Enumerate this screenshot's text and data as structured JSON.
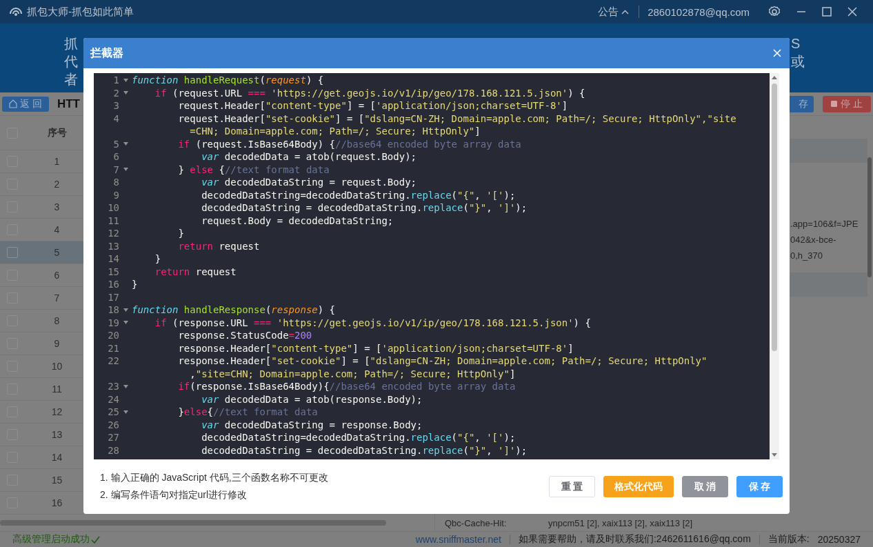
{
  "titlebar": {
    "app_title": "抓包大师-抓包如此简单",
    "notice": "公告",
    "account": "2860102878@qq.com"
  },
  "banner": {
    "rows": [
      {
        "left": "抓",
        "right": "S"
      },
      {
        "left": "代",
        "right": "或"
      },
      {
        "left": "者"
      }
    ]
  },
  "toolbar": {
    "back": "返 回",
    "title": "HTT",
    "save": "存",
    "stop": "停 止"
  },
  "table": {
    "header_checked": false,
    "columns": [
      "序号"
    ],
    "rows": [
      {
        "number": "1",
        "checked": false,
        "selected": false
      },
      {
        "number": "2",
        "checked": false,
        "selected": false
      },
      {
        "number": "3",
        "checked": false,
        "selected": false
      },
      {
        "number": "4",
        "checked": false,
        "selected": false
      },
      {
        "number": "5",
        "checked": false,
        "selected": true
      },
      {
        "number": "6",
        "checked": false,
        "selected": false
      },
      {
        "number": "7",
        "checked": false,
        "selected": false
      },
      {
        "number": "8",
        "checked": false,
        "selected": false
      },
      {
        "number": "9",
        "checked": false,
        "selected": false
      },
      {
        "number": "10",
        "checked": false,
        "selected": false
      },
      {
        "number": "11",
        "checked": false,
        "selected": false
      },
      {
        "number": "12",
        "checked": false,
        "selected": false
      },
      {
        "number": "13",
        "checked": false,
        "selected": false
      },
      {
        "number": "14",
        "checked": false,
        "selected": false
      },
      {
        "number": "15",
        "checked": false,
        "selected": false
      },
      {
        "number": "16",
        "checked": false,
        "selected": false
      }
    ]
  },
  "detail": {
    "lines": [
      ".app=106&f=JPE",
      "042&x-bce-",
      "0,h_370"
    ],
    "header_name": "Qbc-Cache-Hit:",
    "header_value": "ynpcm51 [2], xaix113 [2], xaix113 [2]"
  },
  "dialog": {
    "title": "拦截器",
    "code": [
      {
        "number": "1",
        "fold": true,
        "tokens": [
          {
            "kind": "decl",
            "text": "function"
          },
          {
            "kind": "name",
            "text": " handleRequest"
          },
          {
            "kind": "plain",
            "text": "("
          },
          {
            "kind": "param",
            "text": "request"
          },
          {
            "kind": "plain",
            "text": ") {"
          }
        ]
      },
      {
        "number": "2",
        "fold": true,
        "tokens": [
          {
            "kind": "keyword",
            "text": "    if"
          },
          {
            "kind": "plain",
            "text": " (request.URL "
          },
          {
            "kind": "keyword",
            "text": "==="
          },
          {
            "kind": "string",
            "text": " 'https://get.geojs.io/v1/ip/geo/178.168.121.5.json'"
          },
          {
            "kind": "plain",
            "text": ") {"
          }
        ]
      },
      {
        "number": "3",
        "fold": false,
        "tokens": [
          {
            "kind": "plain",
            "text": "        request.Header["
          },
          {
            "kind": "string",
            "text": "\"content-type\""
          },
          {
            "kind": "plain",
            "text": "] = ["
          },
          {
            "kind": "string",
            "text": "'application/json;charset=UTF-8'"
          },
          {
            "kind": "plain",
            "text": "]"
          }
        ]
      },
      {
        "number": "4",
        "fold": false,
        "tokens": [
          {
            "kind": "plain",
            "text": "        request.Header["
          },
          {
            "kind": "string",
            "text": "\"set-cookie\""
          },
          {
            "kind": "plain",
            "text": "] = ["
          },
          {
            "kind": "string",
            "text": "\"dslang=CN-ZH; Domain=apple.com; Path=/; Secure; HttpOnly\","
          },
          {
            "kind": "string",
            "text": "\"site"
          }
        ]
      },
      {
        "fold": false,
        "tokens": [
          {
            "kind": "string",
            "text": "          =CHN; Domain=apple.com; Path=/; Secure; HttpOnly\""
          },
          {
            "kind": "plain",
            "text": "]"
          }
        ]
      },
      {
        "number": "5",
        "fold": true,
        "tokens": [
          {
            "kind": "keyword",
            "text": "        if"
          },
          {
            "kind": "plain",
            "text": " (request.IsBase64Body) {"
          },
          {
            "kind": "comment",
            "text": "//base64 encoded byte array data"
          }
        ]
      },
      {
        "number": "6",
        "fold": false,
        "tokens": [
          {
            "kind": "decl",
            "text": "            var"
          },
          {
            "kind": "plain",
            "text": " decodedData = atob(request.Body);"
          }
        ]
      },
      {
        "number": "7",
        "fold": true,
        "tokens": [
          {
            "kind": "plain",
            "text": "        } "
          },
          {
            "kind": "keyword",
            "text": "else"
          },
          {
            "kind": "plain",
            "text": " {"
          },
          {
            "kind": "comment",
            "text": "//text format data"
          }
        ]
      },
      {
        "number": "8",
        "fold": false,
        "tokens": [
          {
            "kind": "decl",
            "text": "            var"
          },
          {
            "kind": "plain",
            "text": " decodedDataString = request.Body;"
          }
        ]
      },
      {
        "number": "9",
        "fold": false,
        "tokens": [
          {
            "kind": "plain",
            "text": "            decodedDataString=decodedDataString."
          },
          {
            "kind": "method",
            "text": "replace"
          },
          {
            "kind": "plain",
            "text": "("
          },
          {
            "kind": "string",
            "text": "\"{\""
          },
          {
            "kind": "plain",
            "text": ", "
          },
          {
            "kind": "string",
            "text": "'['"
          },
          {
            "kind": "plain",
            "text": ");"
          }
        ]
      },
      {
        "number": "10",
        "fold": false,
        "tokens": [
          {
            "kind": "plain",
            "text": "            decodedDataString = decodedDataString."
          },
          {
            "kind": "method",
            "text": "replace"
          },
          {
            "kind": "plain",
            "text": "("
          },
          {
            "kind": "string",
            "text": "\"}\""
          },
          {
            "kind": "plain",
            "text": ", "
          },
          {
            "kind": "string",
            "text": "']'"
          },
          {
            "kind": "plain",
            "text": ");"
          }
        ]
      },
      {
        "number": "11",
        "fold": false,
        "tokens": [
          {
            "kind": "plain",
            "text": "            request.Body = decodedDataString;"
          }
        ]
      },
      {
        "number": "12",
        "fold": false,
        "tokens": [
          {
            "kind": "plain",
            "text": "        }"
          }
        ]
      },
      {
        "number": "13",
        "fold": false,
        "tokens": [
          {
            "kind": "keyword",
            "text": "        return"
          },
          {
            "kind": "plain",
            "text": " request"
          }
        ]
      },
      {
        "number": "14",
        "fold": false,
        "tokens": [
          {
            "kind": "plain",
            "text": "    }"
          }
        ]
      },
      {
        "number": "15",
        "fold": false,
        "tokens": [
          {
            "kind": "keyword",
            "text": "    return"
          },
          {
            "kind": "plain",
            "text": " request"
          }
        ]
      },
      {
        "number": "16",
        "fold": false,
        "tokens": [
          {
            "kind": "plain",
            "text": "}"
          }
        ]
      },
      {
        "number": "17",
        "fold": false
      },
      {
        "number": "18",
        "fold": true,
        "tokens": [
          {
            "kind": "decl",
            "text": "function"
          },
          {
            "kind": "name",
            "text": " handleResponse"
          },
          {
            "kind": "plain",
            "text": "("
          },
          {
            "kind": "param",
            "text": "response"
          },
          {
            "kind": "plain",
            "text": ") {"
          }
        ]
      },
      {
        "number": "19",
        "fold": true,
        "tokens": [
          {
            "kind": "keyword",
            "text": "    if"
          },
          {
            "kind": "plain",
            "text": " (response.URL "
          },
          {
            "kind": "keyword",
            "text": "==="
          },
          {
            "kind": "string",
            "text": " 'https://get.geojs.io/v1/ip/geo/178.168.121.5.json'"
          },
          {
            "kind": "plain",
            "text": ") {"
          }
        ]
      },
      {
        "number": "20",
        "fold": false,
        "tokens": [
          {
            "kind": "plain",
            "text": "        response.StatusCode"
          },
          {
            "kind": "keyword",
            "text": "="
          },
          {
            "kind": "number",
            "text": "200"
          }
        ]
      },
      {
        "number": "21",
        "fold": false,
        "tokens": [
          {
            "kind": "plain",
            "text": "        response.Header["
          },
          {
            "kind": "string",
            "text": "\"content-type\""
          },
          {
            "kind": "plain",
            "text": "] = ["
          },
          {
            "kind": "string",
            "text": "'application/json;charset=UTF-8'"
          },
          {
            "kind": "plain",
            "text": "]"
          }
        ]
      },
      {
        "number": "22",
        "fold": false,
        "tokens": [
          {
            "kind": "plain",
            "text": "        response.Header["
          },
          {
            "kind": "string",
            "text": "\"set-cookie\""
          },
          {
            "kind": "plain",
            "text": "] = ["
          },
          {
            "kind": "string",
            "text": "\"dslang=CN-ZH; Domain=apple.com; Path=/; Secure; HttpOnly\""
          }
        ]
      },
      {
        "fold": false,
        "tokens": [
          {
            "kind": "plain",
            "text": "          ,"
          },
          {
            "kind": "string",
            "text": "\"site=CHN; Domain=apple.com; Path=/; Secure; HttpOnly\""
          },
          {
            "kind": "plain",
            "text": "]"
          }
        ]
      },
      {
        "number": "23",
        "fold": true,
        "tokens": [
          {
            "kind": "keyword",
            "text": "        if"
          },
          {
            "kind": "plain",
            "text": "(response.IsBase64Body){"
          },
          {
            "kind": "comment",
            "text": "//base64 encoded byte array data"
          }
        ]
      },
      {
        "number": "24",
        "fold": false,
        "tokens": [
          {
            "kind": "decl",
            "text": "            var"
          },
          {
            "kind": "plain",
            "text": " decodedData = atob(response.Body);"
          }
        ]
      },
      {
        "number": "25",
        "fold": true,
        "tokens": [
          {
            "kind": "plain",
            "text": "        }"
          },
          {
            "kind": "keyword",
            "text": "else"
          },
          {
            "kind": "plain",
            "text": "{"
          },
          {
            "kind": "comment",
            "text": "//text format data"
          }
        ]
      },
      {
        "number": "26",
        "fold": false,
        "tokens": [
          {
            "kind": "decl",
            "text": "            var"
          },
          {
            "kind": "plain",
            "text": " decodedDataString = response.Body;"
          }
        ]
      },
      {
        "number": "27",
        "fold": false,
        "tokens": [
          {
            "kind": "plain",
            "text": "            decodedDataString=decodedDataString."
          },
          {
            "kind": "method",
            "text": "replace"
          },
          {
            "kind": "plain",
            "text": "("
          },
          {
            "kind": "string",
            "text": "\"{\""
          },
          {
            "kind": "plain",
            "text": ", "
          },
          {
            "kind": "string",
            "text": "'['"
          },
          {
            "kind": "plain",
            "text": ");"
          }
        ]
      },
      {
        "number": "28",
        "fold": false,
        "tokens": [
          {
            "kind": "plain",
            "text": "            decodedDataString = decodedDataString."
          },
          {
            "kind": "method",
            "text": "replace"
          },
          {
            "kind": "plain",
            "text": "("
          },
          {
            "kind": "string",
            "text": "\"}\""
          },
          {
            "kind": "plain",
            "text": ", "
          },
          {
            "kind": "string",
            "text": "']'"
          },
          {
            "kind": "plain",
            "text": ");"
          }
        ]
      }
    ],
    "notes": [
      "1. 输入正确的 JavaScript 代码,三个函数名称不可更改",
      "2. 编写条件语句对指定url进行修改"
    ],
    "buttons": [
      {
        "label": "重 置",
        "kind": "default"
      },
      {
        "label": "格式化代码",
        "kind": "warning"
      },
      {
        "label": "取 消",
        "kind": "info"
      },
      {
        "label": "保 存",
        "kind": "primary"
      }
    ]
  },
  "status_bar": {
    "message": "高级管理启动成功",
    "website": "www.sniffmaster.net",
    "help": "如果需要帮助，请及时联系我们:2462611616@qq.com",
    "version_label": "当前版本:",
    "version": "20250327"
  }
}
